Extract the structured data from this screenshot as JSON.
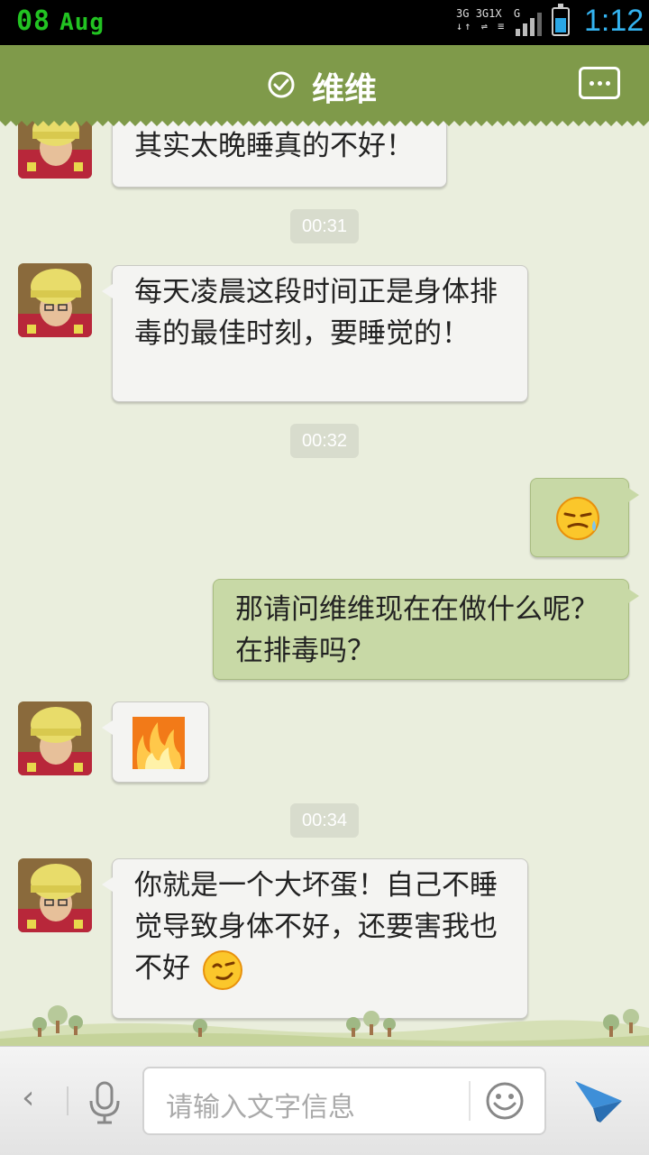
{
  "status_bar": {
    "date_day": "08",
    "date_month": "Aug",
    "network_labels": [
      "3G",
      "3G",
      "1X",
      "G"
    ],
    "time": "1:12",
    "battery_level_percent": 60,
    "time_color": "#34b3f0",
    "date_color": "#22c322"
  },
  "header": {
    "title": "维维",
    "verified_icon": "check-circle-icon",
    "more_icon": "more-dots-icon",
    "background": "#7f9a4a"
  },
  "messages": {
    "m1_text": "其实太晚睡真的不好！",
    "ts1": "00:31",
    "m2_text": "每天凌晨这段时间正是身体排毒的最佳时刻，要睡觉的！",
    "ts2": "00:32",
    "m3_emoji": "sweat-face-emoji",
    "m4_text": "那请问维维现在在做什么呢？在排毒吗？",
    "m5_emoji": "fire-emoji",
    "ts3": "00:34",
    "m6_text": "你就是一个大坏蛋！自己不睡觉导致身体不好，还要害我也不好"
  },
  "input_bar": {
    "placeholder": "请输入文字信息",
    "back_icon": "chevron-left-icon",
    "mic_icon": "microphone-icon",
    "emoji_icon": "smiley-icon",
    "send_icon": "paper-plane-icon"
  }
}
